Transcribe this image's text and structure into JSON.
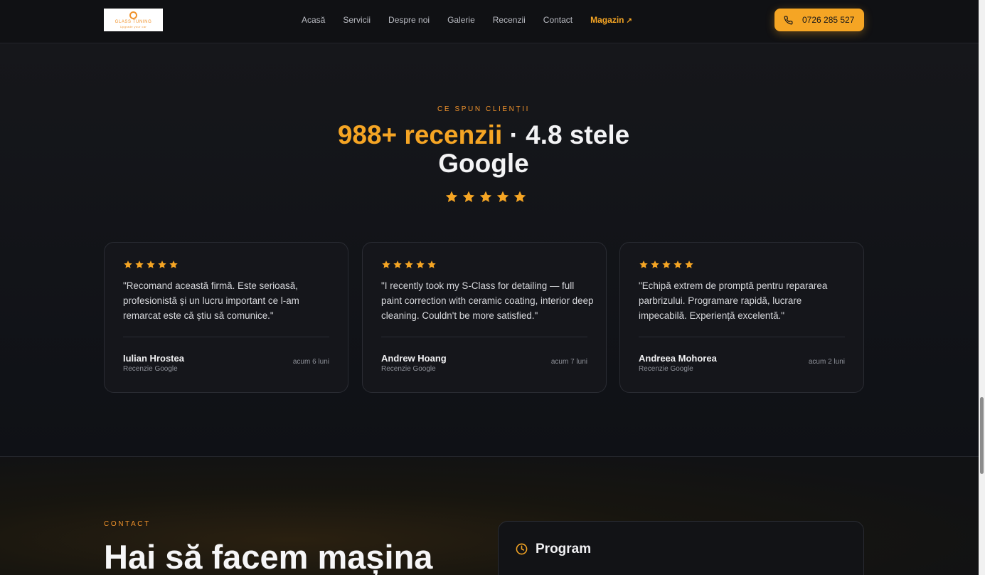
{
  "header": {
    "logo": {
      "name": "GLASS TUNING",
      "tagline": "Upgrade your car"
    },
    "nav": [
      {
        "label": "Acasă"
      },
      {
        "label": "Servicii"
      },
      {
        "label": "Despre noi"
      },
      {
        "label": "Galerie"
      },
      {
        "label": "Recenzii"
      },
      {
        "label": "Contact"
      },
      {
        "label": "Magazin",
        "icon": "external-arrow-icon",
        "accent": true
      }
    ],
    "phone": {
      "label": "0726 285 527",
      "icon": "phone-icon"
    }
  },
  "reviews": {
    "eyebrow": "CE SPUN CLIENȚII",
    "title_accent": "988+ recenzii",
    "title_separator": "·",
    "title_rest_1": "4.8 stele",
    "title_rest_2": "Google",
    "rating_stars": 5,
    "cards": [
      {
        "stars": 5,
        "quote": "\"Recomand această firmă. Este serioasă, profesionistă și un lucru important ce l-am remarcat este că știu să comunice.\"",
        "author": "Iulian Hrostea",
        "source": "Recenzie Google",
        "time": "acum 6 luni"
      },
      {
        "stars": 5,
        "quote": "\"I recently took my S-Class for detailing — full paint correction with ceramic coating, interior deep cleaning. Couldn't be more satisfied.\"",
        "author": "Andrew Hoang",
        "source": "Recenzie Google",
        "time": "acum 7 luni"
      },
      {
        "stars": 5,
        "quote": "\"Echipă extrem de promptă pentru repararea parbrizului. Programare rapidă, lucrare impecabilă. Experiență excelentă.\"",
        "author": "Andreea Mohorea",
        "source": "Recenzie Google",
        "time": "acum 2 luni"
      }
    ]
  },
  "contact": {
    "eyebrow": "CONTACT",
    "title": "Hai să facem mașina",
    "program": {
      "title": "Program",
      "icon": "clock-icon"
    }
  },
  "colors": {
    "accent": "#f5a524",
    "background": "#111318",
    "card_border": "#2a2c33"
  }
}
